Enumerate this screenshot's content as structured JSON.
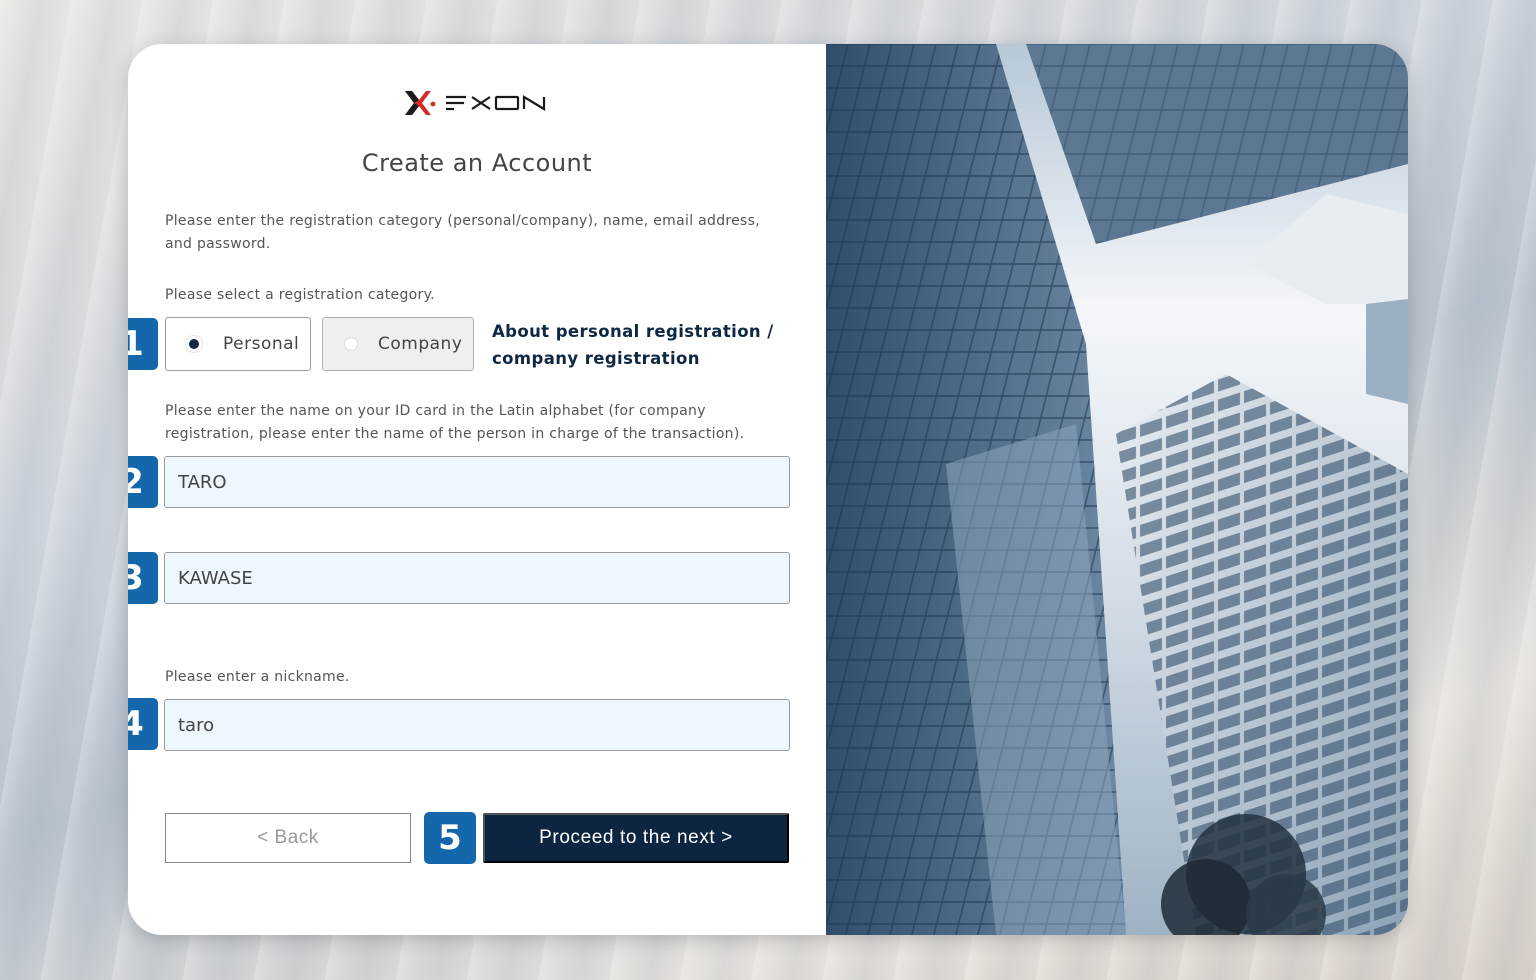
{
  "brand": {
    "name": "FXON",
    "logo_text": "FXON",
    "accent": "#d42a2a",
    "navy": "#0c2540",
    "badge_blue": "#1467ab"
  },
  "page": {
    "title": "Create an Account",
    "intro": "Please enter the registration category (personal/company), name, email address, and password.",
    "category_prompt": "Please select a registration category.",
    "name_prompt": "Please enter the name on your ID card in the Latin alphabet (for company registration, please enter the name of the person in charge of the transaction).",
    "nickname_prompt": "Please enter a nickname."
  },
  "category": {
    "options": [
      {
        "label": "Personal",
        "selected": true
      },
      {
        "label": "Company",
        "selected": false
      }
    ],
    "about_link": "About personal registration / company registration"
  },
  "fields": {
    "first_name": {
      "value": "TARO"
    },
    "last_name": {
      "value": "KAWASE"
    },
    "nickname": {
      "value": "taro"
    }
  },
  "buttons": {
    "back": "< Back",
    "next": "Proceed to the next >"
  },
  "badges": [
    "1",
    "2",
    "3",
    "4",
    "5"
  ]
}
